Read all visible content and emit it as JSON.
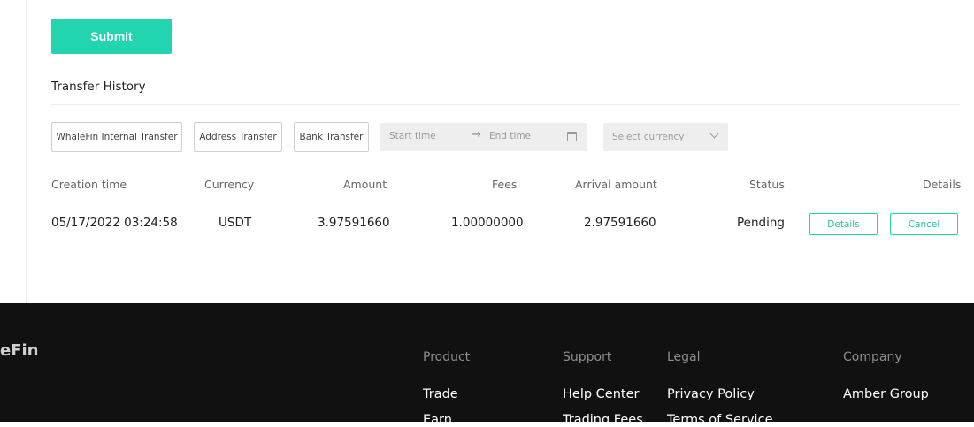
{
  "submit_label": "Submit",
  "history": {
    "title": "Transfer History",
    "filters": {
      "internal": "WhaleFin Internal Transfer",
      "address": "Address Transfer",
      "bank": "Bank Transfer",
      "start_placeholder": "Start time",
      "arrow": "→",
      "end_placeholder": "End time",
      "currency_placeholder": "Select currency"
    },
    "columns": {
      "creation_time": "Creation time",
      "currency": "Currency",
      "amount": "Amount",
      "fees": "Fees",
      "arrival_amount": "Arrival amount",
      "status": "Status",
      "details": "Details"
    },
    "rows": [
      {
        "creation_time": "05/17/2022 03:24:58",
        "currency": "USDT",
        "amount": "3.97591660",
        "fees": "1.00000000",
        "arrival_amount": "2.97591660",
        "status": "Pending",
        "details_label": "Details",
        "cancel_label": "Cancel"
      }
    ]
  },
  "footer": {
    "brand": "eFin",
    "columns": [
      {
        "heading": "Product",
        "links": [
          "Trade",
          "Earn"
        ]
      },
      {
        "heading": "Support",
        "links": [
          "Help Center",
          "Trading Fees"
        ]
      },
      {
        "heading": "Legal",
        "links": [
          "Privacy Policy",
          "Terms of Service"
        ]
      },
      {
        "heading": "Company",
        "links": [
          "Amber Group"
        ]
      }
    ]
  },
  "colors": {
    "accent": "#23d4b0",
    "footer_bg": "#111111"
  }
}
